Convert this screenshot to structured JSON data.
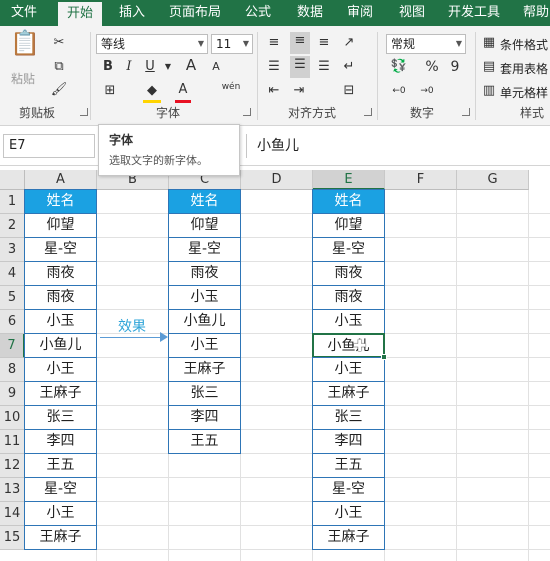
{
  "ribbon_tabs": [
    "文件",
    "开始",
    "插入",
    "页面布局",
    "公式",
    "数据",
    "审阅",
    "视图",
    "开发工具",
    "帮助"
  ],
  "clipboard": {
    "paste_label": "粘贴",
    "group_label": "剪贴板"
  },
  "font": {
    "name": "等线",
    "size": "11",
    "group_label": "字体",
    "bold": "B",
    "italic": "I",
    "underline": "U",
    "grow": "A",
    "shrink": "A",
    "font_color": "A",
    "phonetic": "wén",
    "highlight_letter": "A"
  },
  "alignment": {
    "group_label": "对齐方式"
  },
  "number": {
    "format": "常规",
    "group_label": "数字",
    "percent": "%",
    "comma": "9"
  },
  "styles": {
    "conditional": "条件格式",
    "table": "套用表格",
    "cell": "单元格样",
    "group_label": "样式"
  },
  "tooltip": {
    "title": "字体",
    "desc": "选取文字的新字体。"
  },
  "formula_bar": {
    "name_box": "E7",
    "formula": "小鱼儿"
  },
  "columns": [
    "A",
    "B",
    "C",
    "D",
    "E",
    "F",
    "G"
  ],
  "selected_column": "E",
  "rows": [
    "1",
    "2",
    "3",
    "4",
    "5",
    "6",
    "7",
    "8",
    "9",
    "10",
    "11",
    "12",
    "13",
    "14",
    "15"
  ],
  "selected_row": "7",
  "col_a": [
    "姓名",
    "仰望",
    "星-空",
    "雨夜",
    "雨夜",
    "小玉",
    "小鱼儿",
    "小王",
    "王麻子",
    "张三",
    "李四",
    "王五",
    "星-空",
    "小王",
    "王麻子"
  ],
  "col_c": [
    "姓名",
    "仰望",
    "星-空",
    "雨夜",
    "小玉",
    "小鱼儿",
    "小王",
    "王麻子",
    "张三",
    "李四",
    "王五"
  ],
  "col_e": [
    "姓名",
    "仰望",
    "星-空",
    "雨夜",
    "雨夜",
    "小玉",
    "小鱼儿",
    "小王",
    "王麻子",
    "张三",
    "李四",
    "王五",
    "星-空",
    "小王",
    "王麻子"
  ],
  "annotation": "效果",
  "colors": {
    "ribbon": "#217346",
    "header_fill": "#1ba1e2",
    "table_border": "#2e75b6",
    "annotation": "#2ea4d8"
  }
}
